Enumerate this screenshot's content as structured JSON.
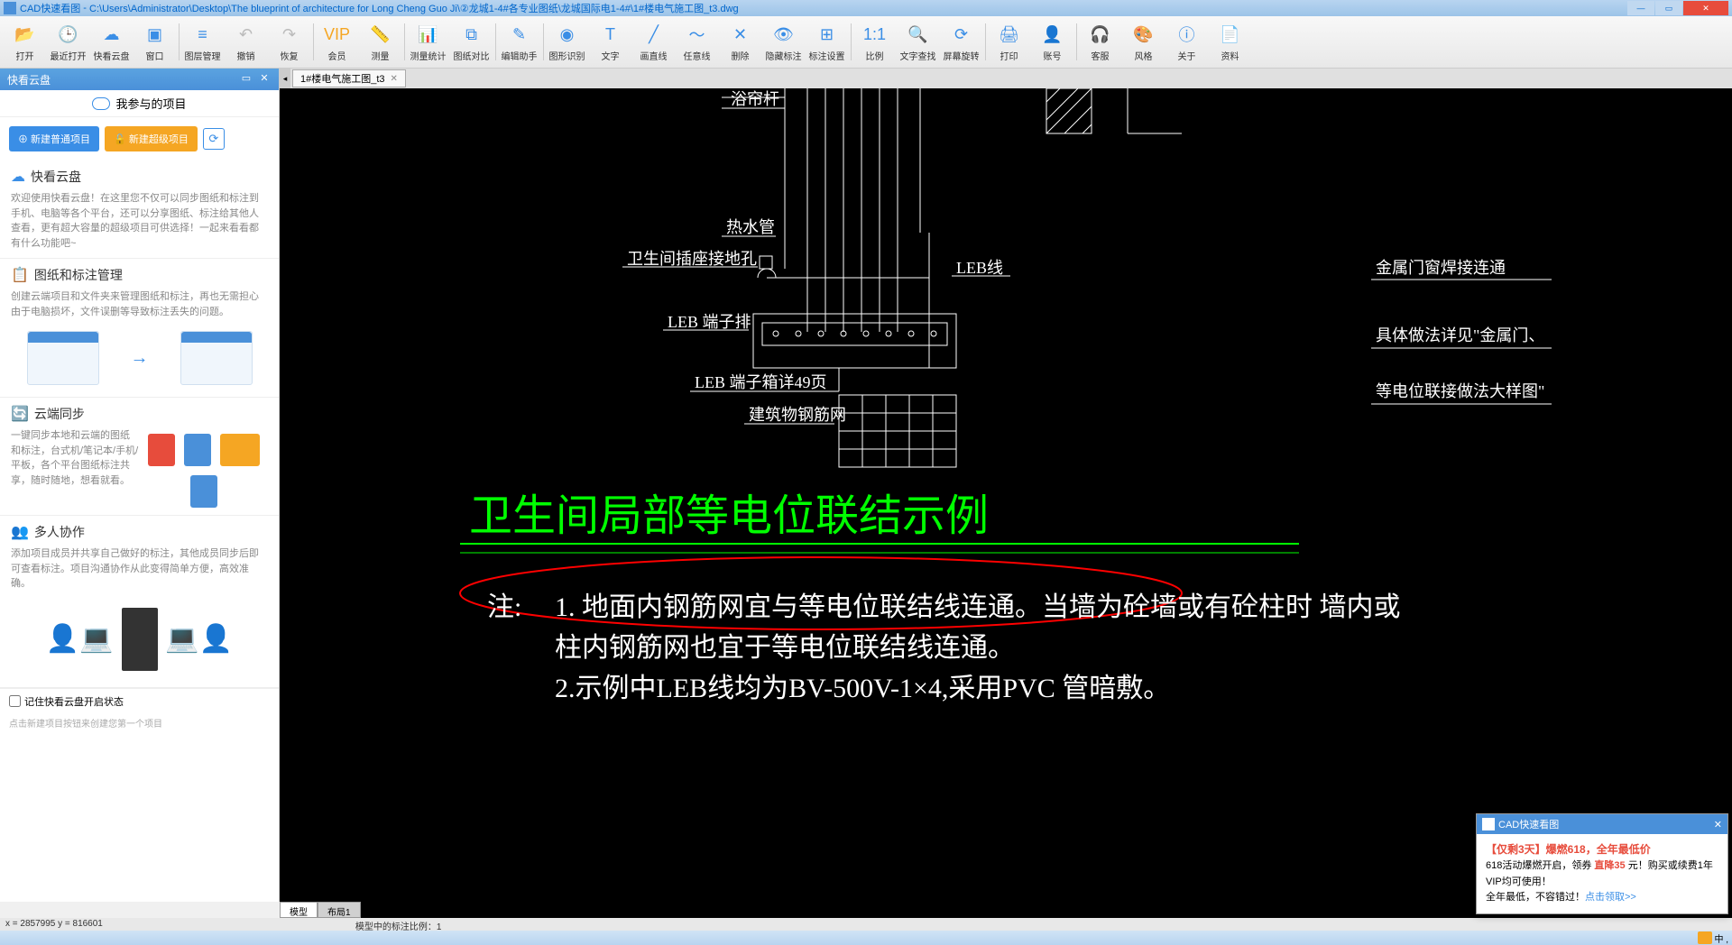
{
  "titlebar": {
    "app": "CAD快速看图",
    "path": "C:\\Users\\Administrator\\Desktop\\The blueprint of architecture for Long Cheng Guo Ji\\②龙城1-4#各专业图纸\\龙城国际电1-4#\\1#楼电气施工图_t3.dwg"
  },
  "toolbar": [
    {
      "label": "打开",
      "icon": "📂"
    },
    {
      "label": "最近打开",
      "icon": "🕒"
    },
    {
      "label": "快看云盘",
      "icon": "☁"
    },
    {
      "label": "窗口",
      "icon": "▣"
    },
    {
      "label": "图层管理",
      "icon": "≡"
    },
    {
      "label": "撤销",
      "icon": "↶",
      "disabled": true
    },
    {
      "label": "恢复",
      "icon": "↷",
      "disabled": true
    },
    {
      "label": "会员",
      "icon": "VIP",
      "vip": true
    },
    {
      "label": "测量",
      "icon": "📏"
    },
    {
      "label": "测量统计",
      "icon": "📊"
    },
    {
      "label": "图纸对比",
      "icon": "⧉"
    },
    {
      "label": "编辑助手",
      "icon": "✎"
    },
    {
      "label": "图形识别",
      "icon": "◉"
    },
    {
      "label": "文字",
      "icon": "T"
    },
    {
      "label": "画直线",
      "icon": "╱"
    },
    {
      "label": "任意线",
      "icon": "～"
    },
    {
      "label": "删除",
      "icon": "✕"
    },
    {
      "label": "隐藏标注",
      "icon": "👁"
    },
    {
      "label": "标注设置",
      "icon": "⊞"
    },
    {
      "label": "比例",
      "icon": "1:1"
    },
    {
      "label": "文字查找",
      "icon": "🔍"
    },
    {
      "label": "屏幕旋转",
      "icon": "⟳"
    },
    {
      "label": "打印",
      "icon": "🖨"
    },
    {
      "label": "账号",
      "icon": "👤"
    },
    {
      "label": "客服",
      "icon": "🎧"
    },
    {
      "label": "风格",
      "icon": "🎨"
    },
    {
      "label": "关于",
      "icon": "ⓘ"
    },
    {
      "label": "资料",
      "icon": "📄"
    }
  ],
  "sidebar": {
    "header": "快看云盘",
    "project_header": "我参与的项目",
    "btn_new_normal": "⊕ 新建普通项目",
    "btn_new_super": "🔓 新建超级项目",
    "section_cloud": {
      "title": "快看云盘",
      "desc": "欢迎使用快看云盘！在这里您不仅可以同步图纸和标注到手机、电脑等各个平台，还可以分享图纸、标注给其他人查看，更有超大容量的超级项目可供选择！一起来看看都有什么功能吧~"
    },
    "section_manage": {
      "title": "图纸和标注管理",
      "desc": "创建云端项目和文件夹来管理图纸和标注，再也无需担心由于电脑损坏，文件误删等导致标注丢失的问题。"
    },
    "section_sync": {
      "title": "云端同步",
      "desc": "一键同步本地和云端的图纸和标注，台式机/笔记本/手机/平板，各个平台图纸标注共享，随时随地，想看就看。"
    },
    "section_collab": {
      "title": "多人协作",
      "desc": "添加项目成员并共享自己做好的标注，其他成员同步后即可查看标注。项目沟通协作从此变得简单方便，高效准确。"
    },
    "checkbox_label": "记住快看云盘开启状态",
    "footer_hint": "点击新建项目按钮来创建您第一个项目"
  },
  "tab": {
    "name": "1#楼电气施工图_t3"
  },
  "cad_labels": {
    "l1": "浴帘杆",
    "l2": "热水管",
    "l3": "卫生间插座接地孔",
    "l4": "LEB线",
    "l5": "LEB 端子排",
    "l6": "LEB 端子箱详49页",
    "l7": "建筑物钢筋网",
    "r1": "金属门窗焊接连通",
    "r2": "具体做法详见\"金属门、",
    "r3": "等电位联接做法大样图\"",
    "title": "卫生间局部等电位联结示例",
    "note_label": "注:",
    "note1a": "1. 地面内钢筋网宜与等电位联结线连通。当墙为砼墙或有砼柱时 墙内或",
    "note1b": "柱内钢筋网也宜于等电位联结线连通。",
    "note2": "2.示例中LEB线均为BV-500V-1×4,采用PVC 管暗敷。"
  },
  "bottom_tabs": [
    "模型",
    "布局1"
  ],
  "status": {
    "coords": "x = 2857995  y = 816601",
    "scale": "模型中的标注比例：1"
  },
  "promo": {
    "header": "CAD快速看图",
    "title": "【仅剩3天】爆燃618，全年最低价",
    "line1a": "618活动爆燃开启，领券 ",
    "price": "直降35",
    "line1b": " 元！购买或续费1年VIP均可使用！",
    "line2": "全年最低，不容错过！",
    "link": "点击领取>>"
  },
  "ime": "中 ,  "
}
